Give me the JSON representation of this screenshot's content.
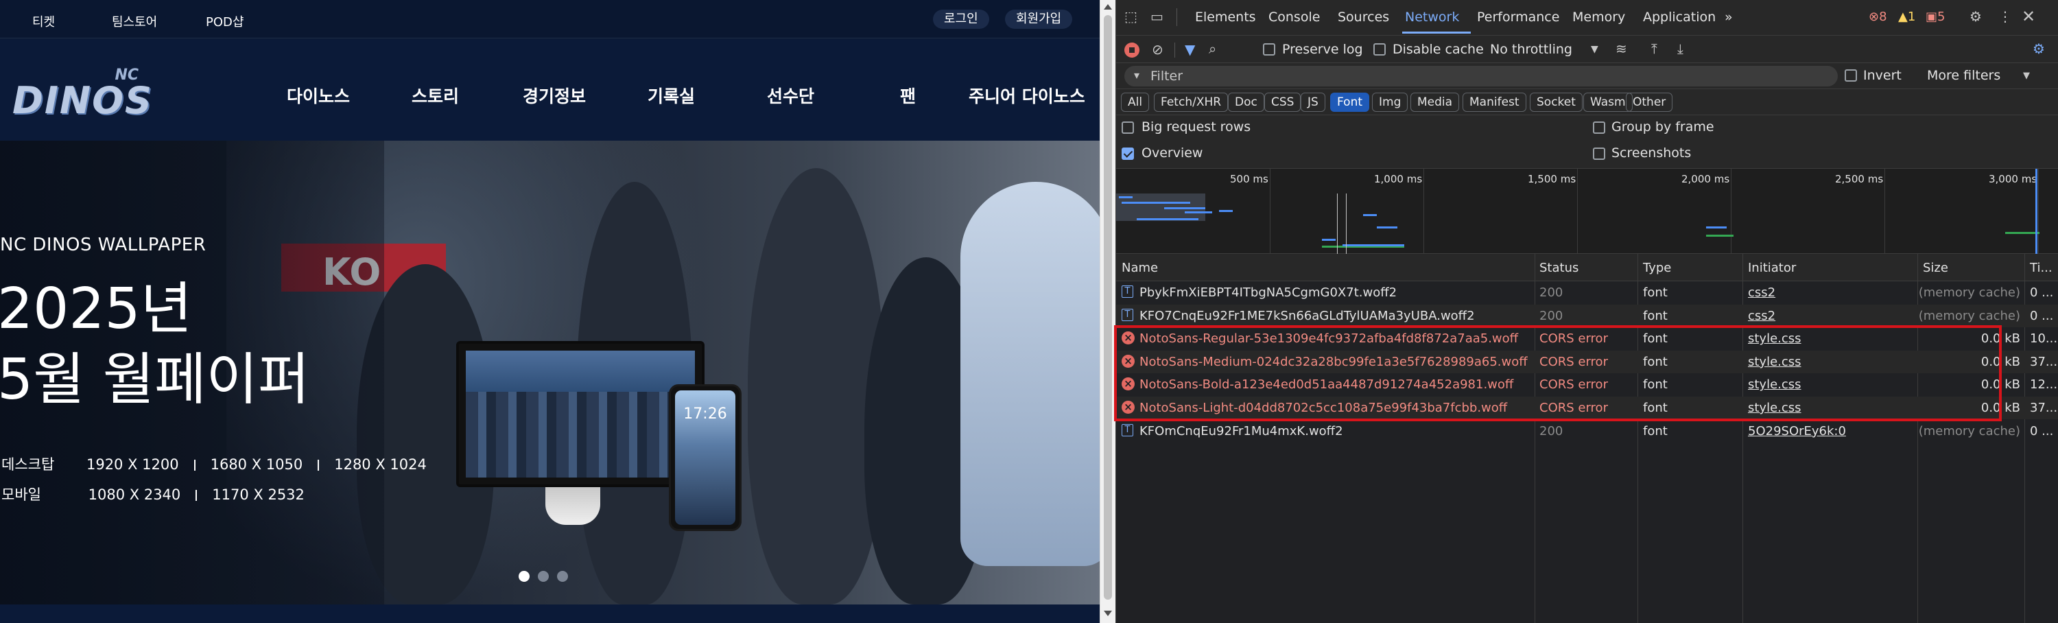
{
  "site": {
    "topbar": {
      "links": [
        "티켓",
        "팀스토어",
        "POD샵"
      ],
      "login": "로그인",
      "signup": "회원가입"
    },
    "logo": {
      "small": "NC",
      "word": "DINOS"
    },
    "nav": [
      "다이노스",
      "스토리",
      "경기정보",
      "기록실",
      "선수단",
      "팬",
      "주니어 다이노스"
    ],
    "hero": {
      "subtitle": "NC DINOS WALLPAPER",
      "title_line1": "2025년",
      "title_line2": "5월 월페이퍼",
      "desktop_label": "데스크탑",
      "desktop_sizes": [
        "1920 X 1200",
        "1680 X 1050",
        "1280 X 1024"
      ],
      "mobile_label": "모바일",
      "mobile_sizes": [
        "1080 X 2340",
        "1170 X 2532"
      ],
      "phone_time": "17:26",
      "banner_text": "KO",
      "slide_count": 3,
      "active_slide": 1
    }
  },
  "devtools": {
    "tabs": [
      "Elements",
      "Console",
      "Sources",
      "Network",
      "Performance",
      "Memory",
      "Application"
    ],
    "active_tab": "Network",
    "more_tabs": "»",
    "counts": {
      "errors": "8",
      "warnings": "1",
      "issues": "5"
    },
    "toolbar": {
      "preserve_log": "Preserve log",
      "disable_cache": "Disable cache",
      "throttling": "No throttling"
    },
    "filter": {
      "placeholder": "Filter",
      "invert": "Invert",
      "more_filters": "More filters"
    },
    "type_chips": [
      "All",
      "Fetch/XHR",
      "Doc",
      "CSS",
      "JS",
      "Font",
      "Img",
      "Media",
      "Manifest",
      "Socket",
      "Wasm",
      "Other"
    ],
    "active_chip": "Font",
    "options": {
      "big_rows": "Big request rows",
      "group_by_frame": "Group by frame",
      "overview": "Overview",
      "screenshots": "Screenshots"
    },
    "overview_ticks": [
      "500 ms",
      "1,000 ms",
      "1,500 ms",
      "2,000 ms",
      "2,500 ms",
      "3,000 ms"
    ],
    "columns": [
      "Name",
      "Status",
      "Type",
      "Initiator",
      "Size",
      "Ti..."
    ],
    "rows": [
      {
        "name": "PbykFmXiEBPT4ITbgNA5CgmG0X7t.woff2",
        "status": "200",
        "type": "font",
        "initiator": "css2",
        "size": "(memory cache)",
        "time": "0 ...",
        "error": false
      },
      {
        "name": "KFO7CnqEu92Fr1ME7kSn66aGLdTylUAMa3yUBA.woff2",
        "status": "200",
        "type": "font",
        "initiator": "css2",
        "size": "(memory cache)",
        "time": "0 ...",
        "error": false
      },
      {
        "name": "NotoSans-Regular-53e1309e4fc9372afba4fd8f872a7aa5.woff",
        "status": "CORS error",
        "type": "font",
        "initiator": "style.css",
        "size": "0.0 kB",
        "time": "10...",
        "error": true
      },
      {
        "name": "NotoSans-Medium-024dc32a28bc99fe1a3e5f7628989a65.woff",
        "status": "CORS error",
        "type": "font",
        "initiator": "style.css",
        "size": "0.0 kB",
        "time": "37...",
        "error": true
      },
      {
        "name": "NotoSans-Bold-a123e4ed0d51aa4487d91274a452a981.woff",
        "status": "CORS error",
        "type": "font",
        "initiator": "style.css",
        "size": "0.0 kB",
        "time": "12...",
        "error": true
      },
      {
        "name": "NotoSans-Light-d04dd8702c5cc108a75e99f43ba7fcbb.woff",
        "status": "CORS error",
        "type": "font",
        "initiator": "style.css",
        "size": "0.0 kB",
        "time": "37...",
        "error": true
      },
      {
        "name": "KFOmCnqEu92Fr1Mu4mxK.woff2",
        "status": "200",
        "type": "font",
        "initiator": "5O29SOrEy6k:0",
        "size": "(memory cache)",
        "time": "0 ...",
        "error": false
      }
    ],
    "colors": {
      "accent": "#7cacf8",
      "error": "#f28b82",
      "highlight": "#d8141b"
    }
  }
}
